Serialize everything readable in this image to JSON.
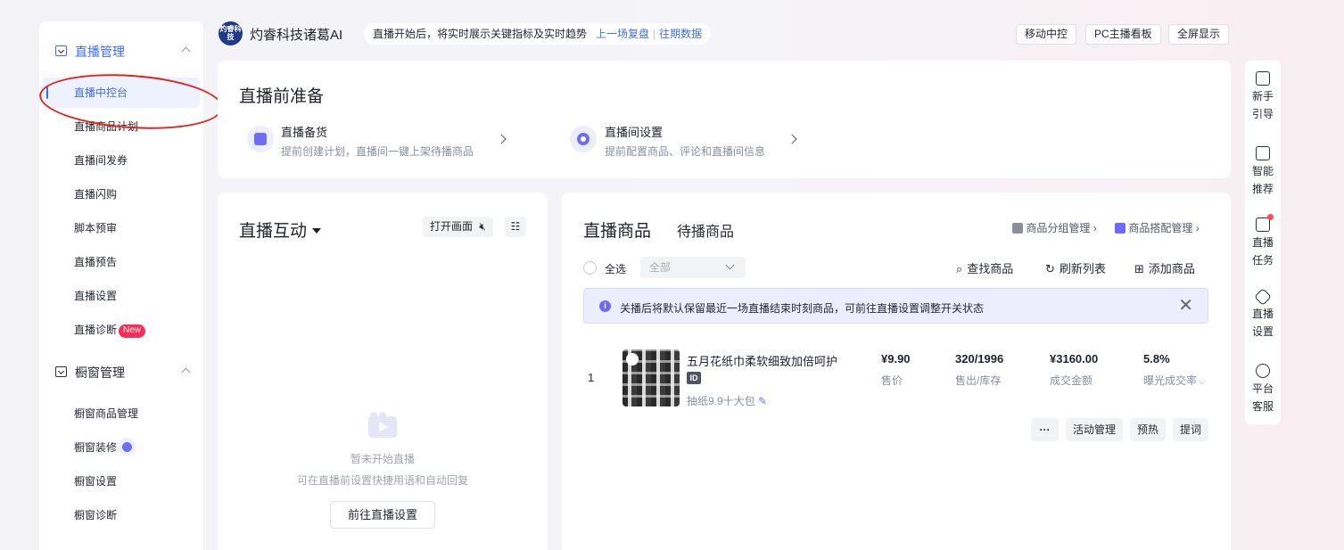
{
  "sidebar": {
    "sections": [
      {
        "label": "直播管理",
        "items": [
          "直播中控台",
          "直播商品计划",
          "直播间发券",
          "直播闪购",
          "脚本预审",
          "直播预告",
          "直播设置",
          "直播诊断"
        ],
        "new_badge": "New"
      },
      {
        "label": "橱窗管理",
        "items": [
          "橱窗商品管理",
          "橱窗装修",
          "橱窗设置",
          "橱窗诊断"
        ]
      }
    ]
  },
  "header": {
    "logo_text": "灼睿科技",
    "brand": "灼睿科技诸葛AI",
    "notice": "直播开始后，将实时展示关键指标及实时趋势",
    "link_last": "上一场复盘",
    "sep": "|",
    "link_history": "往期数据",
    "buttons": [
      "移动中控",
      "PC主播看板",
      "全屏显示"
    ]
  },
  "prep": {
    "title": "直播前准备",
    "items": [
      {
        "title": "直播备货",
        "sub": "提前创建计划，直播间一键上架待播商品"
      },
      {
        "title": "直播间设置",
        "sub": "提前配置商品、评论和直播间信息"
      }
    ]
  },
  "interact": {
    "title": "直播互动",
    "open_screen": "打开画面",
    "empty_title": "暂未开始直播",
    "empty_sub": "可在直播前设置快捷用语和自动回复",
    "goto_button": "前往直播设置"
  },
  "goods": {
    "tabs": [
      "直播商品",
      "待播商品"
    ],
    "group_manage": "商品分组管理",
    "combo_manage": "商品搭配管理",
    "select_all": "全选",
    "filter_value": "全部",
    "find": "查找商品",
    "refresh": "刷新列表",
    "add": "添加商品",
    "notice": "关播后将默认保留最近一场直播结束时刻商品，可前往直播设置调整开关状态",
    "rows": [
      {
        "index": "1",
        "name": "五月花纸巾柔软细致加倍呵护",
        "id_tag": "ID",
        "tag": "抽纸9.9十大包",
        "price": "¥9.90",
        "price_label": "售价",
        "sold": "320/1996",
        "sold_label": "售出/库存",
        "amount": "¥3160.00",
        "amount_label": "成交金额",
        "rate": "5.8%",
        "rate_label": "曝光成交率",
        "buttons": [
          "活动管理",
          "预热",
          "提词"
        ],
        "more": "···"
      }
    ]
  },
  "rail": [
    {
      "l1": "新手",
      "l2": "引导",
      "icon": "book-icon"
    },
    {
      "l1": "智能",
      "l2": "推荐",
      "icon": "robot-icon"
    },
    {
      "l1": "直播",
      "l2": "任务",
      "icon": "task-icon"
    },
    {
      "l1": "直播",
      "l2": "设置",
      "icon": "settings-icon"
    },
    {
      "l1": "平台",
      "l2": "客服",
      "icon": "headset-icon"
    }
  ],
  "colors": {
    "accent": "#3d6df5",
    "purple": "#6e6cf5",
    "annotation": "#e0231c"
  }
}
